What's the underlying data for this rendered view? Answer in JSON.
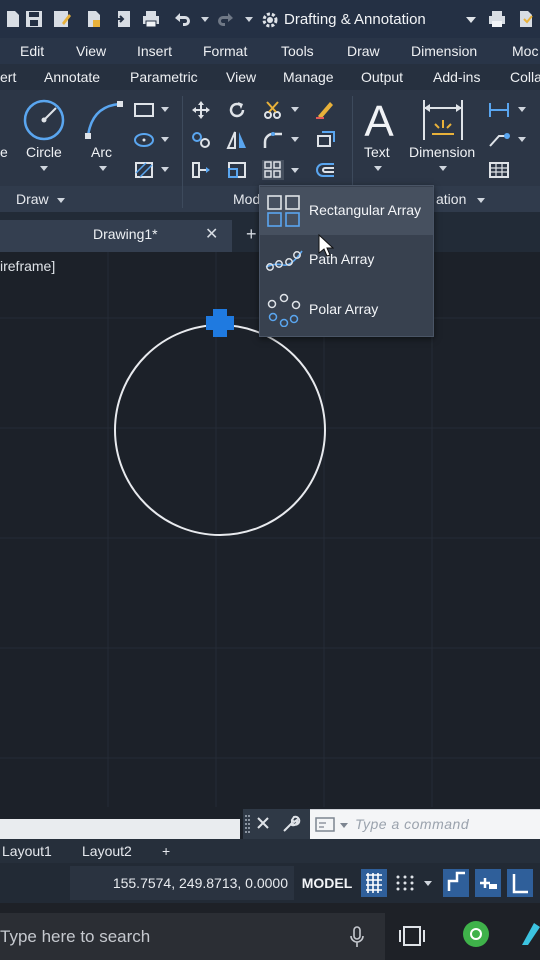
{
  "workspace": {
    "name": "Drafting & Annotation"
  },
  "menu_bar": [
    "Edit",
    "View",
    "Insert",
    "Format",
    "Tools",
    "Draw",
    "Dimension",
    "Moc"
  ],
  "ribbon_tabs": [
    "ert",
    "Annotate",
    "Parametric",
    "View",
    "Manage",
    "Output",
    "Add-ins",
    "Colla"
  ],
  "ribbon": {
    "draw_panel": {
      "title": "Draw",
      "left_tool_label": "e",
      "circle_label": "Circle",
      "arc_label": "Arc"
    },
    "modify_panel": {
      "title": "Mod"
    },
    "annotation_panel": {
      "title": "ation",
      "text_label": "Text",
      "dimension_label": "Dimension"
    }
  },
  "file_tab": {
    "name": "Drawing1*",
    "close": "✕",
    "new": "+"
  },
  "viewport": {
    "style_label": "ireframe]"
  },
  "array_menu": {
    "items": [
      {
        "label": "Rectangular Array",
        "icon": "rectangular-array-icon"
      },
      {
        "label": "Path Array",
        "icon": "path-array-icon"
      },
      {
        "label": "Polar Array",
        "icon": "polar-array-icon"
      }
    ]
  },
  "command_line": {
    "placeholder": "Type a command"
  },
  "layout_tabs": [
    "Layout1",
    "Layout2",
    "+"
  ],
  "status_bar": {
    "coordinates": "155.7574, 249.8713, 0.0000",
    "space": "MODEL"
  },
  "taskbar": {
    "search_placeholder": "Type here to search"
  },
  "colors": {
    "accent": "#3a8fe8",
    "grip": "#1f7ae0",
    "canvas": "#1c2129",
    "ribbon": "#2c3646"
  }
}
